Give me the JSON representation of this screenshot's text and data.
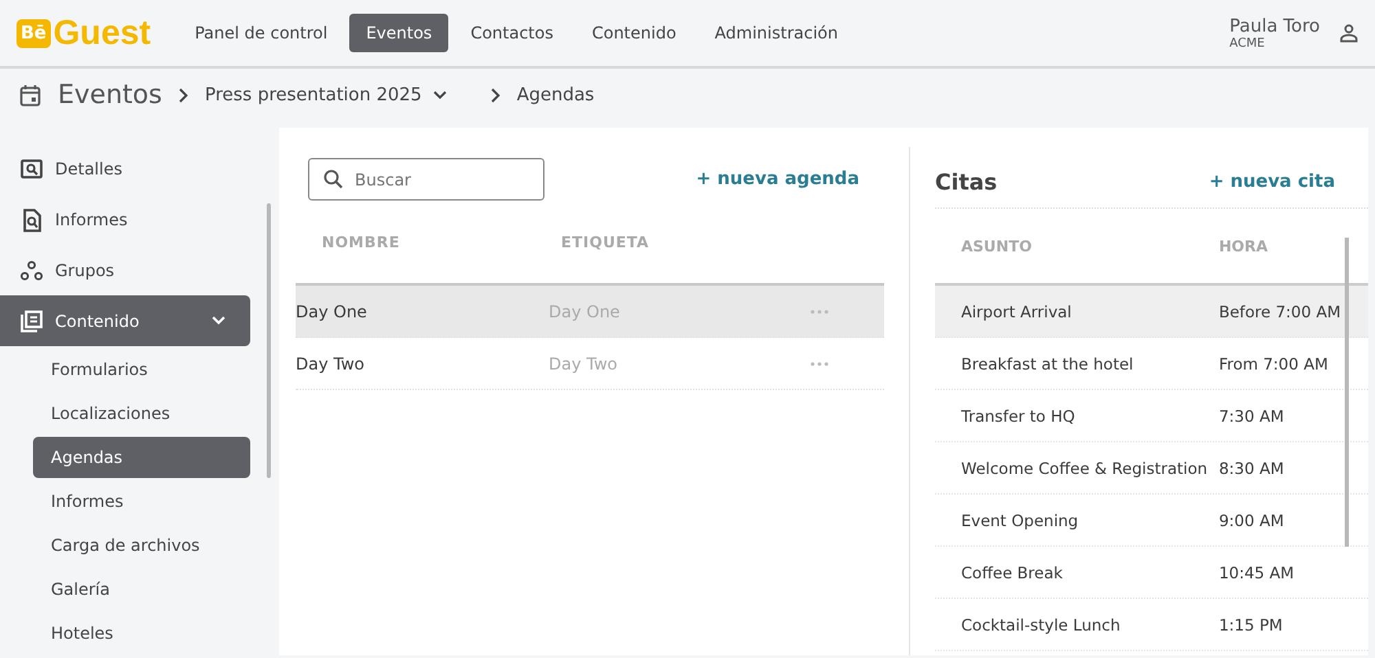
{
  "logo": {
    "badge": "Bē",
    "word": "Guest"
  },
  "nav": [
    {
      "label": "Panel de control",
      "selected": false
    },
    {
      "label": "Eventos",
      "selected": true
    },
    {
      "label": "Contactos",
      "selected": false
    },
    {
      "label": "Contenido",
      "selected": false
    },
    {
      "label": "Administración",
      "selected": false
    }
  ],
  "user": {
    "name": "Paula Toro",
    "org": "ACME"
  },
  "breadcrumb": {
    "title": "Eventos",
    "event": "Press presentation 2025",
    "page": "Agendas"
  },
  "sidebar": {
    "items": [
      {
        "label": "Detalles",
        "selected": false
      },
      {
        "label": "Informes",
        "selected": false
      },
      {
        "label": "Grupos",
        "selected": false
      },
      {
        "label": "Contenido",
        "selected": true,
        "expanded": true,
        "children": [
          {
            "label": "Formularios",
            "selected": false
          },
          {
            "label": "Localizaciones",
            "selected": false
          },
          {
            "label": "Agendas",
            "selected": true
          },
          {
            "label": "Informes",
            "selected": false
          },
          {
            "label": "Carga de archivos",
            "selected": false
          },
          {
            "label": "Galería",
            "selected": false
          },
          {
            "label": "Hoteles",
            "selected": false
          }
        ]
      }
    ]
  },
  "agendas": {
    "search": {
      "placeholder": "Buscar"
    },
    "new_button": "+ nueva agenda",
    "columns": [
      "NOMBRE",
      "ETIQUETA"
    ],
    "rows": [
      {
        "name": "Day One",
        "tag": "Day One",
        "selected": true
      },
      {
        "name": "Day Two",
        "tag": "Day Two",
        "selected": false
      }
    ]
  },
  "citas": {
    "title": "Citas",
    "new_button": "+ nueva cita",
    "columns": [
      "ASUNTO",
      "HORA"
    ],
    "rows": [
      {
        "subject": "Airport Arrival",
        "time": "Before 7:00 AM",
        "selected": true
      },
      {
        "subject": "Breakfast at the hotel",
        "time": "From 7:00 AM",
        "selected": false
      },
      {
        "subject": "Transfer to HQ",
        "time": "7:30 AM",
        "selected": false
      },
      {
        "subject": "Welcome Coffee & Registration",
        "time": "8:30 AM",
        "selected": false
      },
      {
        "subject": "Event Opening",
        "time": "9:00 AM",
        "selected": false
      },
      {
        "subject": "Coffee Break",
        "time": "10:45 AM",
        "selected": false
      },
      {
        "subject": "Cocktail-style Lunch",
        "time": "1:15 PM",
        "selected": false
      }
    ]
  }
}
